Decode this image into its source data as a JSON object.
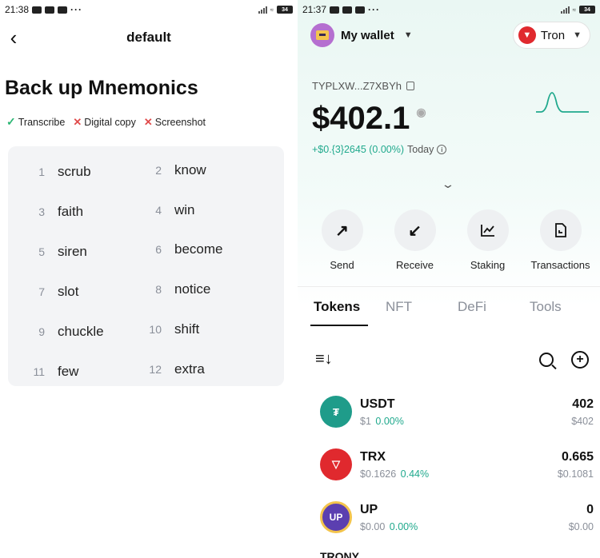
{
  "left": {
    "status_time": "21:38",
    "status_dots": "···",
    "battery": "34",
    "title": "default",
    "heading": "Back up Mnemonics",
    "warnings": [
      {
        "icon": "check",
        "label": "Transcribe"
      },
      {
        "icon": "cross",
        "label": "Digital copy"
      },
      {
        "icon": "cross",
        "label": "Screenshot"
      }
    ],
    "words": [
      {
        "n": "1",
        "w": "scrub"
      },
      {
        "n": "2",
        "w": "know"
      },
      {
        "n": "3",
        "w": "faith"
      },
      {
        "n": "4",
        "w": "win"
      },
      {
        "n": "5",
        "w": "siren"
      },
      {
        "n": "6",
        "w": "become"
      },
      {
        "n": "7",
        "w": "slot"
      },
      {
        "n": "8",
        "w": "notice"
      },
      {
        "n": "9",
        "w": "chuckle"
      },
      {
        "n": "10",
        "w": "shift"
      },
      {
        "n": "11",
        "w": "few"
      },
      {
        "n": "12",
        "w": "extra"
      }
    ]
  },
  "right": {
    "status_time": "21:37",
    "status_dots": "···",
    "battery": "34",
    "wallet_name": "My wallet",
    "network": "Tron",
    "address": "TYPLXW...Z7XBYh",
    "balance": "$402.1",
    "change_amount": "+$0.{3}2645 (0.00%)",
    "change_period": "Today",
    "actions": [
      {
        "label": "Send",
        "icon": "arrow-up-right"
      },
      {
        "label": "Receive",
        "icon": "arrow-down-left"
      },
      {
        "label": "Staking",
        "icon": "chart"
      },
      {
        "label": "Transactions",
        "icon": "document"
      }
    ],
    "tabs": [
      "Tokens",
      "NFT",
      "DeFi",
      "Tools"
    ],
    "tokens": [
      {
        "symbol": "USDT",
        "price": "$1",
        "pct": "0.00%",
        "amount": "402",
        "value": "$402",
        "color": "#1f9c8a",
        "glyph": "₮"
      },
      {
        "symbol": "TRX",
        "price": "$0.1626",
        "pct": "0.44%",
        "amount": "0.665",
        "value": "$0.1081",
        "color": "#e0292e",
        "glyph": "▽"
      },
      {
        "symbol": "UP",
        "price": "$0.00",
        "pct": "0.00%",
        "amount": "0",
        "value": "$0.00",
        "color": "#5b3fb0",
        "glyph": "UP"
      }
    ],
    "partial_token": "TRONY"
  }
}
